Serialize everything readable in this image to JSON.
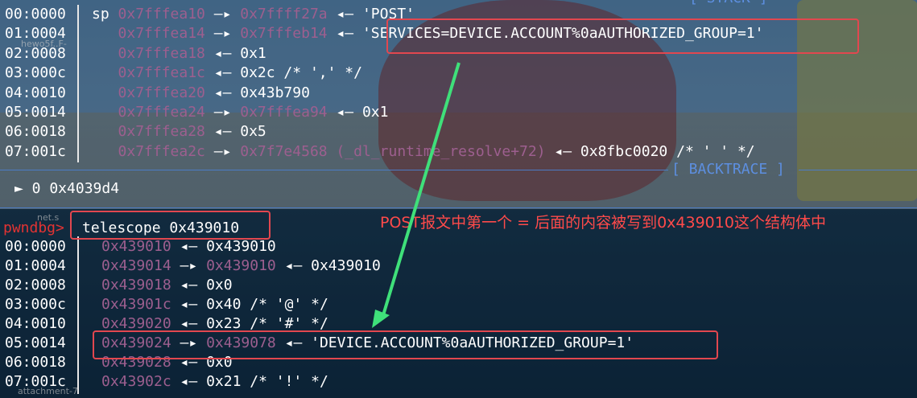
{
  "stack_header": "[ STACK ]",
  "stack_rows": [
    {
      "off": "00:0000",
      "pre": "sp ",
      "a": "0x7fffea10",
      "arrow": " —▸ ",
      "b": "0x7ffff27a",
      "rest": " ◂— 'POST'"
    },
    {
      "off": "01:0004",
      "pre": "   ",
      "a": "0x7fffea14",
      "arrow": " —▸ ",
      "b": "0x7fffeb14",
      "rest": " ◂— 'SERVICES=DEVICE.ACCOUNT%0aAUTHORIZED_GROUP=1'"
    },
    {
      "off": "02:0008",
      "pre": "   ",
      "a": "0x7fffea18",
      "arrow": " ◂— ",
      "b": "",
      "rest": "0x1"
    },
    {
      "off": "03:000c",
      "pre": "   ",
      "a": "0x7fffea1c",
      "arrow": " ◂— ",
      "b": "",
      "rest": "0x2c /* ',' */"
    },
    {
      "off": "04:0010",
      "pre": "   ",
      "a": "0x7fffea20",
      "arrow": " ◂— ",
      "b": "",
      "rest": "0x43b790"
    },
    {
      "off": "05:0014",
      "pre": "   ",
      "a": "0x7fffea24",
      "arrow": " —▸ ",
      "b": "0x7fffea94",
      "rest": " ◂— 0x1"
    },
    {
      "off": "06:0018",
      "pre": "   ",
      "a": "0x7fffea28",
      "arrow": " ◂— ",
      "b": "",
      "rest": "0x5"
    },
    {
      "off": "07:001c",
      "pre": "   ",
      "a": "0x7fffea2c",
      "arrow": " —▸ ",
      "b": "0x7f7e4568 (_dl_runtime_resolve+72)",
      "rest": " ◂— 0x8fbc0020 /* ' ' */"
    }
  ],
  "backtrace_header": "[ BACKTRACE ]",
  "backtrace": "► 0 0x4039d4",
  "prompt": "pwndbg>",
  "command": "telescope 0x439010",
  "annotation": "POST报文中第一个 = 后面的内容被写到0x439010这个结构体中",
  "tele_rows": [
    {
      "off": "00:0000",
      "a": "0x439010",
      "arrow": " ◂— ",
      "b": "",
      "rest": "0x439010"
    },
    {
      "off": "01:0004",
      "a": "0x439014",
      "arrow": " —▸ ",
      "b": "0x439010",
      "rest": " ◂— 0x439010"
    },
    {
      "off": "02:0008",
      "a": "0x439018",
      "arrow": " ◂— ",
      "b": "",
      "rest": "0x0"
    },
    {
      "off": "03:000c",
      "a": "0x43901c",
      "arrow": " ◂— ",
      "b": "",
      "rest": "0x40 /* '@' */"
    },
    {
      "off": "04:0010",
      "a": "0x439020",
      "arrow": " ◂— ",
      "b": "",
      "rest": "0x23 /* '#' */"
    },
    {
      "off": "05:0014",
      "a": "0x439024",
      "arrow": " —▸ ",
      "b": "0x439078",
      "rest": " ◂— 'DEVICE.ACCOUNT%0aAUTHORIZED_GROUP=1'"
    },
    {
      "off": "06:0018",
      "a": "0x439028",
      "arrow": " ◂— ",
      "b": "",
      "rest": "0x0"
    },
    {
      "off": "07:001c",
      "a": "0x43902c",
      "arrow": " ◂— ",
      "b": "",
      "rest": "0x21 /* '!' */"
    }
  ],
  "faint_labels": [
    "hewo5f..F-",
    "net.s",
    "attachment-7"
  ],
  "colors": {
    "highlight": "#e2474f",
    "arrow": "#3fe07a",
    "addr": "#9d5f8f",
    "prompt": "#e23333",
    "separator": "#4c7cc5"
  }
}
